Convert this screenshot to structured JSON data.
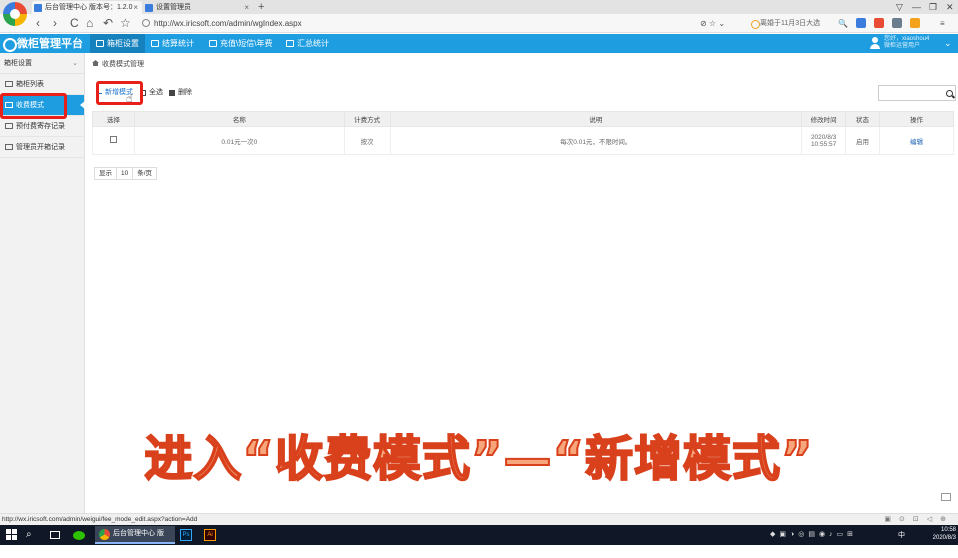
{
  "browser": {
    "tabs": [
      {
        "label": "后台管理中心 版本号：1.2.0",
        "close": "×"
      },
      {
        "label": "设置管理员",
        "close": "×"
      }
    ],
    "new_tab": "+",
    "url": "http://wx.iricsoft.com/admin/wgIndex.aspx",
    "search_hint": "离婚于11月3日大选",
    "window_controls": [
      "▽",
      "—",
      "❐",
      "✕"
    ],
    "nav": [
      "‹",
      "›",
      "C",
      "⌂",
      "↶",
      "☆"
    ]
  },
  "app": {
    "brand": "微柜管理平台",
    "nav": [
      "箱柜设置",
      "结算统计",
      "充值\\短信\\年费",
      "汇总统计"
    ],
    "user_line1": "您好，xiaoshou4",
    "user_line2": "微柜运营用户"
  },
  "sidebar": {
    "header": "箱柜设置",
    "items": [
      "箱柜列表",
      "收费模式",
      "预付费寄存记录",
      "管理员开箱记录"
    ]
  },
  "main": {
    "breadcrumb": "收费模式管理",
    "toolbar": {
      "add": "新增模式",
      "select_all": "全选",
      "delete": "删除"
    },
    "table": {
      "headers": [
        "选择",
        "名称",
        "计费方式",
        "说明",
        "修改时间",
        "状态",
        "操作"
      ],
      "rows": [
        {
          "name": "0.01元一次0",
          "billing": "按次",
          "desc": "每次0.01元，不限时间。",
          "time_date": "2020/8/3",
          "time_clock": "10:55:57",
          "status": "启用",
          "action": "编辑"
        }
      ]
    },
    "pager": {
      "show": "显示",
      "size": "10",
      "unit": "条/页"
    }
  },
  "caption": "进入“收费模式”—“新增模式”",
  "statusbar": {
    "url": "http://wx.iricsoft.com/admin/weigui/fee_mode_edit.aspx?action=Add"
  },
  "taskbar": {
    "browser_label": "后台管理中心 版本...",
    "ps_label": "Ps",
    "ai_label": "Ai",
    "ime": "中",
    "time": "10:58",
    "date": "2020/8/3"
  },
  "colors": {
    "accent": "#1e9de0",
    "highlight": "#e8201a",
    "caption_fill": "#f6a67a",
    "caption_stroke": "#d9411c"
  }
}
